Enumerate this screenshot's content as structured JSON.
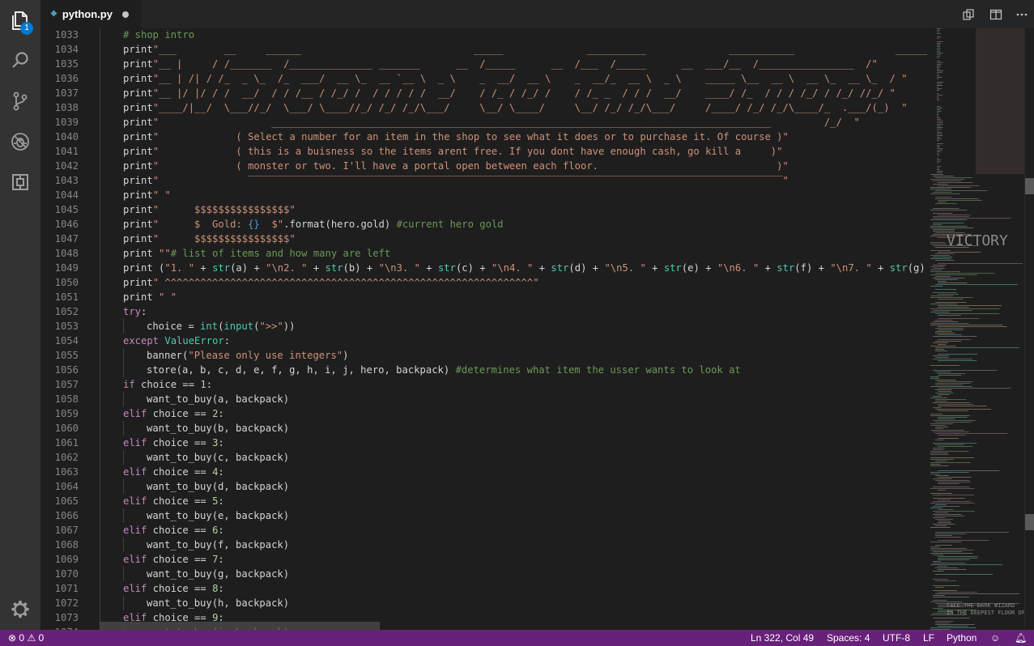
{
  "tab": {
    "file_name": "python.py",
    "file_icon": "python-file-icon",
    "modified": true
  },
  "activity_bar": {
    "items": [
      {
        "name": "explorer-icon",
        "badge": "1"
      },
      {
        "name": "search-icon"
      },
      {
        "name": "source-control-icon"
      },
      {
        "name": "debug-icon"
      },
      {
        "name": "extensions-icon"
      }
    ],
    "settings_icon": "gear-icon"
  },
  "editor_actions": [
    "open-changes-icon",
    "split-editor-icon",
    "more-actions-icon"
  ],
  "code_lines": [
    {
      "n": "1033",
      "indent": 1,
      "tokens": [
        [
          "cmt",
          "# shop intro"
        ]
      ]
    },
    {
      "n": "1034",
      "indent": 1,
      "tokens": [
        [
          "plain",
          "print"
        ],
        [
          "str",
          "\"___        __     ______                             _____              __________              ___________                 ______\""
        ]
      ]
    },
    {
      "n": "1035",
      "indent": 1,
      "tokens": [
        [
          "plain",
          "print"
        ],
        [
          "str",
          "\"__ |     / /_______  /______________ _______      __  /_____      __  /___  /_____      __  ___/__  /________________  /\""
        ]
      ]
    },
    {
      "n": "1036",
      "indent": 1,
      "tokens": [
        [
          "plain",
          "print"
        ],
        [
          "str",
          "\"__ | /| / /_  _ \\_  /_  ___/  __ \\_  __ `__ \\  _ \\    _  __/  __ \\    _  __/_  __ \\  _ \\    _____ \\__  __ \\  __ \\_  __ \\_  / \""
        ]
      ]
    },
    {
      "n": "1037",
      "indent": 1,
      "tokens": [
        [
          "plain",
          "print"
        ],
        [
          "str",
          "\"__ |/ |/ / /  __/  / / /__ / /_/ /  / / / / /  __/    / /_ / /_/ /    / /_ _  / / /  __/    ____/ /_  / / / /_/ / /_/ //_/ \""
        ]
      ]
    },
    {
      "n": "1038",
      "indent": 1,
      "tokens": [
        [
          "plain",
          "print"
        ],
        [
          "str",
          "\"____/|__/  \\___//_/  \\___/ \\____//_/ /_/ /_/\\___/     \\__/ \\____/     \\__/ /_/ /_/\\___/     /____/ /_/ /_/\\____/_  .___/(_)  \""
        ]
      ]
    },
    {
      "n": "1039",
      "indent": 1,
      "tokens": [
        [
          "plain",
          "print"
        ],
        [
          "str",
          "\"                   ____________________________________________________________________________________         /_/  \""
        ]
      ]
    },
    {
      "n": "1040",
      "indent": 1,
      "tokens": [
        [
          "plain",
          "print"
        ],
        [
          "str",
          "\"             ( Select a number for an item in the shop to see what it does or to purchase it. Of course )\""
        ]
      ]
    },
    {
      "n": "1041",
      "indent": 1,
      "tokens": [
        [
          "plain",
          "print"
        ],
        [
          "str",
          "\"             ( this is a buisness so the items arent free. If you dont have enough cash, go kill a     )\""
        ]
      ]
    },
    {
      "n": "1042",
      "indent": 1,
      "tokens": [
        [
          "plain",
          "print"
        ],
        [
          "str",
          "\"             ( monster or two. I'll have a portal open between each floor.                              )\""
        ]
      ]
    },
    {
      "n": "1043",
      "indent": 1,
      "tokens": [
        [
          "plain",
          "print"
        ],
        [
          "str",
          "\"               ‾‾‾‾‾‾‾‾‾‾‾‾‾‾‾‾‾‾‾‾‾‾‾‾‾‾‾‾‾‾‾‾‾‾‾‾‾‾‾‾‾‾‾‾‾‾‾‾‾‾‾‾‾‾‾‾‾‾‾‾‾‾‾‾‾‾‾‾‾‾‾‾‾‾‾‾‾‾‾‾‾‾‾‾‾‾‾‾‾‾\""
        ]
      ]
    },
    {
      "n": "1044",
      "indent": 1,
      "tokens": [
        [
          "plain",
          "print"
        ],
        [
          "str",
          "\" \""
        ]
      ]
    },
    {
      "n": "1045",
      "indent": 1,
      "tokens": [
        [
          "plain",
          "print"
        ],
        [
          "str",
          "\"      $$$$$$$$$$$$$$$$\""
        ]
      ]
    },
    {
      "n": "1046",
      "indent": 1,
      "tokens": [
        [
          "plain",
          "print"
        ],
        [
          "str",
          "\"      $  Gold: "
        ],
        [
          "brace",
          "{}"
        ],
        [
          "str",
          "  $\""
        ],
        [
          "plain",
          ".format(hero.gold) "
        ],
        [
          "cmt",
          "#current hero gold"
        ]
      ]
    },
    {
      "n": "1047",
      "indent": 1,
      "tokens": [
        [
          "plain",
          "print"
        ],
        [
          "str",
          "\"      $$$$$$$$$$$$$$$$\""
        ]
      ]
    },
    {
      "n": "1048",
      "indent": 1,
      "tokens": [
        [
          "plain",
          "print "
        ],
        [
          "str",
          "\"\""
        ],
        [
          "cmt",
          "# list of items and how many are left"
        ]
      ]
    },
    {
      "n": "1049",
      "indent": 1,
      "tokens": [
        [
          "plain",
          "print ("
        ],
        [
          "str",
          "\"1. \""
        ],
        [
          "plain",
          " + "
        ],
        [
          "bi",
          "str"
        ],
        [
          "plain",
          "(a) + "
        ],
        [
          "str",
          "\"\\n2. \""
        ],
        [
          "plain",
          " + "
        ],
        [
          "bi",
          "str"
        ],
        [
          "plain",
          "(b) + "
        ],
        [
          "str",
          "\"\\n3. \""
        ],
        [
          "plain",
          " + "
        ],
        [
          "bi",
          "str"
        ],
        [
          "plain",
          "(c) + "
        ],
        [
          "str",
          "\"\\n4. \""
        ],
        [
          "plain",
          " + "
        ],
        [
          "bi",
          "str"
        ],
        [
          "plain",
          "(d) + "
        ],
        [
          "str",
          "\"\\n5. \""
        ],
        [
          "plain",
          " + "
        ],
        [
          "bi",
          "str"
        ],
        [
          "plain",
          "(e) + "
        ],
        [
          "str",
          "\"\\n6. \""
        ],
        [
          "plain",
          " + "
        ],
        [
          "bi",
          "str"
        ],
        [
          "plain",
          "(f) + "
        ],
        [
          "str",
          "\"\\n7. \""
        ],
        [
          "plain",
          " + "
        ],
        [
          "bi",
          "str"
        ],
        [
          "plain",
          "(g) +"
        ]
      ]
    },
    {
      "n": "1050",
      "indent": 1,
      "tokens": [
        [
          "plain",
          "print"
        ],
        [
          "str",
          "\" ^^^^^^^^^^^^^^^^^^^^^^^^^^^^^^^^^^^^^^^^^^^^^^^^^^^^^^^^^^^^^^\""
        ]
      ]
    },
    {
      "n": "1051",
      "indent": 1,
      "tokens": [
        [
          "plain",
          "print "
        ],
        [
          "str",
          "\" \""
        ]
      ]
    },
    {
      "n": "1052",
      "indent": 1,
      "tokens": [
        [
          "kw",
          "try"
        ],
        [
          "plain",
          ":"
        ]
      ]
    },
    {
      "n": "1053",
      "indent": 2,
      "tokens": [
        [
          "plain",
          "choice = "
        ],
        [
          "bi",
          "int"
        ],
        [
          "plain",
          "("
        ],
        [
          "bi",
          "input"
        ],
        [
          "plain",
          "("
        ],
        [
          "str",
          "\">>\""
        ],
        [
          "plain",
          "))"
        ]
      ]
    },
    {
      "n": "1054",
      "indent": 1,
      "tokens": [
        [
          "kw",
          "except "
        ],
        [
          "bi",
          "ValueError"
        ],
        [
          "plain",
          ":"
        ]
      ]
    },
    {
      "n": "1055",
      "indent": 2,
      "tokens": [
        [
          "plain",
          "banner("
        ],
        [
          "str",
          "\"Please only use integers\""
        ],
        [
          "plain",
          ")"
        ]
      ]
    },
    {
      "n": "1056",
      "indent": 2,
      "tokens": [
        [
          "plain",
          "store(a, b, c, d, e, f, g, h, i, j, hero, backpack) "
        ],
        [
          "cmt",
          "#determines what item the usser wants to look at"
        ]
      ]
    },
    {
      "n": "1057",
      "indent": 1,
      "tokens": [
        [
          "kw",
          "if"
        ],
        [
          "plain",
          " choice == "
        ],
        [
          "num",
          "1"
        ],
        [
          "plain",
          ":"
        ]
      ]
    },
    {
      "n": "1058",
      "indent": 2,
      "tokens": [
        [
          "plain",
          "want_to_buy(a, backpack)"
        ]
      ]
    },
    {
      "n": "1059",
      "indent": 1,
      "tokens": [
        [
          "kw",
          "elif"
        ],
        [
          "plain",
          " choice == "
        ],
        [
          "num",
          "2"
        ],
        [
          "plain",
          ":"
        ]
      ]
    },
    {
      "n": "1060",
      "indent": 2,
      "tokens": [
        [
          "plain",
          "want_to_buy(b, backpack)"
        ]
      ]
    },
    {
      "n": "1061",
      "indent": 1,
      "tokens": [
        [
          "kw",
          "elif"
        ],
        [
          "plain",
          " choice == "
        ],
        [
          "num",
          "3"
        ],
        [
          "plain",
          ":"
        ]
      ]
    },
    {
      "n": "1062",
      "indent": 2,
      "tokens": [
        [
          "plain",
          "want_to_buy(c, backpack)"
        ]
      ]
    },
    {
      "n": "1063",
      "indent": 1,
      "tokens": [
        [
          "kw",
          "elif"
        ],
        [
          "plain",
          " choice == "
        ],
        [
          "num",
          "4"
        ],
        [
          "plain",
          ":"
        ]
      ]
    },
    {
      "n": "1064",
      "indent": 2,
      "tokens": [
        [
          "plain",
          "want_to_buy(d, backpack)"
        ]
      ]
    },
    {
      "n": "1065",
      "indent": 1,
      "tokens": [
        [
          "kw",
          "elif"
        ],
        [
          "plain",
          " choice == "
        ],
        [
          "num",
          "5"
        ],
        [
          "plain",
          ":"
        ]
      ]
    },
    {
      "n": "1066",
      "indent": 2,
      "tokens": [
        [
          "plain",
          "want_to_buy(e, backpack)"
        ]
      ]
    },
    {
      "n": "1067",
      "indent": 1,
      "tokens": [
        [
          "kw",
          "elif"
        ],
        [
          "plain",
          " choice == "
        ],
        [
          "num",
          "6"
        ],
        [
          "plain",
          ":"
        ]
      ]
    },
    {
      "n": "1068",
      "indent": 2,
      "tokens": [
        [
          "plain",
          "want_to_buy(f, backpack)"
        ]
      ]
    },
    {
      "n": "1069",
      "indent": 1,
      "tokens": [
        [
          "kw",
          "elif"
        ],
        [
          "plain",
          " choice == "
        ],
        [
          "num",
          "7"
        ],
        [
          "plain",
          ":"
        ]
      ]
    },
    {
      "n": "1070",
      "indent": 2,
      "tokens": [
        [
          "plain",
          "want_to_buy(g, backpack)"
        ]
      ]
    },
    {
      "n": "1071",
      "indent": 1,
      "tokens": [
        [
          "kw",
          "elif"
        ],
        [
          "plain",
          " choice == "
        ],
        [
          "num",
          "8"
        ],
        [
          "plain",
          ":"
        ]
      ]
    },
    {
      "n": "1072",
      "indent": 2,
      "tokens": [
        [
          "plain",
          "want_to_buy(h, backpack)"
        ]
      ]
    },
    {
      "n": "1073",
      "indent": 1,
      "tokens": [
        [
          "kw",
          "elif"
        ],
        [
          "plain",
          " choice == "
        ],
        [
          "num",
          "9"
        ],
        [
          "plain",
          ":"
        ]
      ]
    },
    {
      "n": "1074",
      "indent": 2,
      "tokens": [
        [
          "plain",
          "want_to_buy(i, backpack)"
        ]
      ]
    }
  ],
  "minimap": {
    "text_fragments": [
      "VICTORY",
      "FACE THE DARK WIZARD",
      "IN THE DEEPEST FLOOR OF"
    ]
  },
  "status_bar": {
    "errors": "0",
    "warnings": "0",
    "error_icon": "error-icon",
    "warning_icon": "warning-icon",
    "position": "Ln 322, Col 49",
    "indentation": "Spaces: 4",
    "encoding": "UTF-8",
    "eol": "LF",
    "language": "Python",
    "feedback_icon": "smiley-icon",
    "notifications_icon": "bell-icon"
  },
  "colors": {
    "status_bar": "#68217a",
    "activity_bar": "#333333",
    "editor_bg": "#1e1e1e",
    "badge": "#007acc"
  }
}
